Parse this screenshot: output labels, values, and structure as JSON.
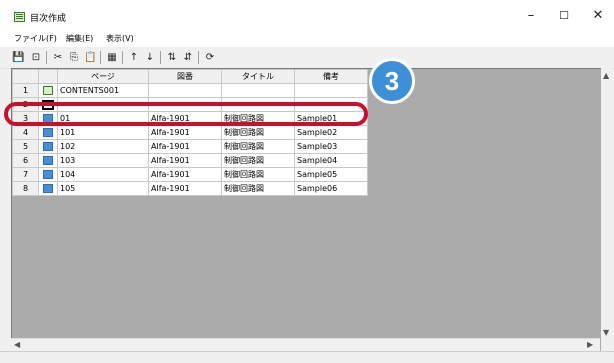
{
  "window": {
    "title": "目次作成",
    "minimize": "–",
    "maximize": "☐",
    "close": "✕"
  },
  "menu": [
    "ファイル(F)",
    "編集(E)",
    "表示(V)"
  ],
  "toolbar": [
    "💾",
    "⊡",
    "✂",
    "⎘",
    "📋",
    "▦",
    "↑",
    "↓",
    "⇅",
    "⇵",
    "⟳"
  ],
  "columns": [
    "ページ",
    "図番",
    "タイトル",
    "備考"
  ],
  "rows": [
    {
      "n": "1",
      "icon": "book",
      "page": "CONTENTS001",
      "zuban": "",
      "title": "",
      "note": ""
    },
    {
      "n": "2",
      "icon": "select",
      "page": "",
      "zuban": "",
      "title": "",
      "note": ""
    },
    {
      "n": "3",
      "icon": "page",
      "page": "01",
      "zuban": "Alfa-1901",
      "title": "制御回路図",
      "note": "Sample01"
    },
    {
      "n": "4",
      "icon": "page",
      "page": "101",
      "zuban": "Alfa-1901",
      "title": "制御回路図",
      "note": "Sample02"
    },
    {
      "n": "5",
      "icon": "page",
      "page": "102",
      "zuban": "Alfa-1901",
      "title": "制御回路図",
      "note": "Sample03"
    },
    {
      "n": "6",
      "icon": "page",
      "page": "103",
      "zuban": "Alfa-1901",
      "title": "制御回路図",
      "note": "Sample04"
    },
    {
      "n": "7",
      "icon": "page",
      "page": "104",
      "zuban": "Alfa-1901",
      "title": "制御回路図",
      "note": "Sample05"
    },
    {
      "n": "8",
      "icon": "page",
      "page": "105",
      "zuban": "Alfa-1901",
      "title": "制御回路図",
      "note": "Sample06"
    }
  ],
  "step_badge": "3",
  "colors": {
    "highlight": "#c8102e",
    "badge": "#3d8fd6"
  }
}
